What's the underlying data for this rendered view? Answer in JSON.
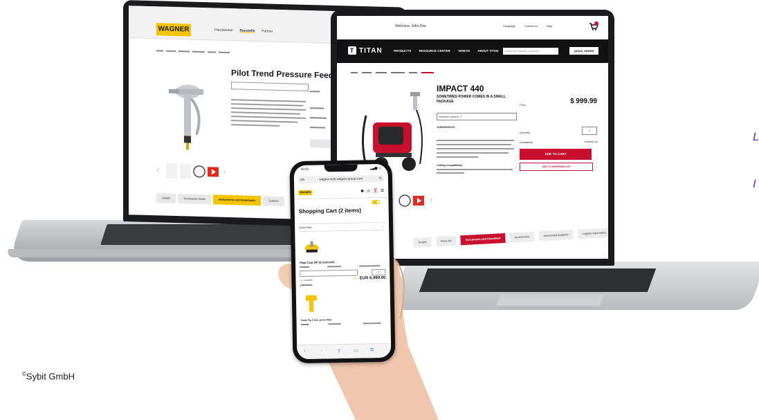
{
  "copyright": "Sybit GmbH",
  "copyright_symbol": "©",
  "edge_fragments": [
    "L",
    "I"
  ],
  "wagner": {
    "logo": "WAGNER",
    "nav": [
      "Handwerker",
      "Baustelle",
      "Partner"
    ],
    "title": "Pilot Trend Pressure Feed",
    "tabs": [
      "Details",
      "Technische Daten",
      "Dokumente und Downloads",
      "Zubehör"
    ],
    "active_tab": "Dokumente und Downloads"
  },
  "titan": {
    "welcome": "Welcome, John Doe",
    "top_links": [
      "Language",
      "Contact us",
      "Help"
    ],
    "logo": "TITAN",
    "nav": [
      "PRODUCTS",
      "RESOURCE CENTER",
      "VIDEOS",
      "ABOUT TITAN"
    ],
    "search_placeholder": "Search for models, numbers",
    "quick_order": "QUICK ORDER",
    "title": "IMPACT 440",
    "subtitle": "SOMETIMES POWER COMES IN A SMALL PACKAGE",
    "variant": "Selected variant: T",
    "sku": "115633090122",
    "price": "$ 999.99",
    "quantity_label": "Quantity",
    "quantity": "1",
    "availability_label": "Availability",
    "availability": "Available",
    "price_label": "Price",
    "add_to_cart": "ADD TO CART",
    "add_to_list": "ADD TO SHOPPING LIST",
    "coating_label": "Coating compatibility:",
    "tabs": [
      "Details",
      "Parts list",
      "Documents and Download",
      "Accessories",
      "Associated products",
      "Logistic information"
    ],
    "active_tab": "Documents and Download"
  },
  "phone": {
    "time": "09:53",
    "url": "wagner-b2b.wagner-group.com",
    "url_aa": "AA",
    "logo": "WAGNER",
    "cart_title": "Shopping Cart (2 items)",
    "quick_order": "Quick Order",
    "item1": {
      "name": "Plast Coat HP 36 Sammelh",
      "price": "EUR 6,990.00",
      "availability": "Available",
      "discount": "37%"
    },
    "item2": {
      "name": "Trade Tip 3 411, green filter"
    }
  }
}
